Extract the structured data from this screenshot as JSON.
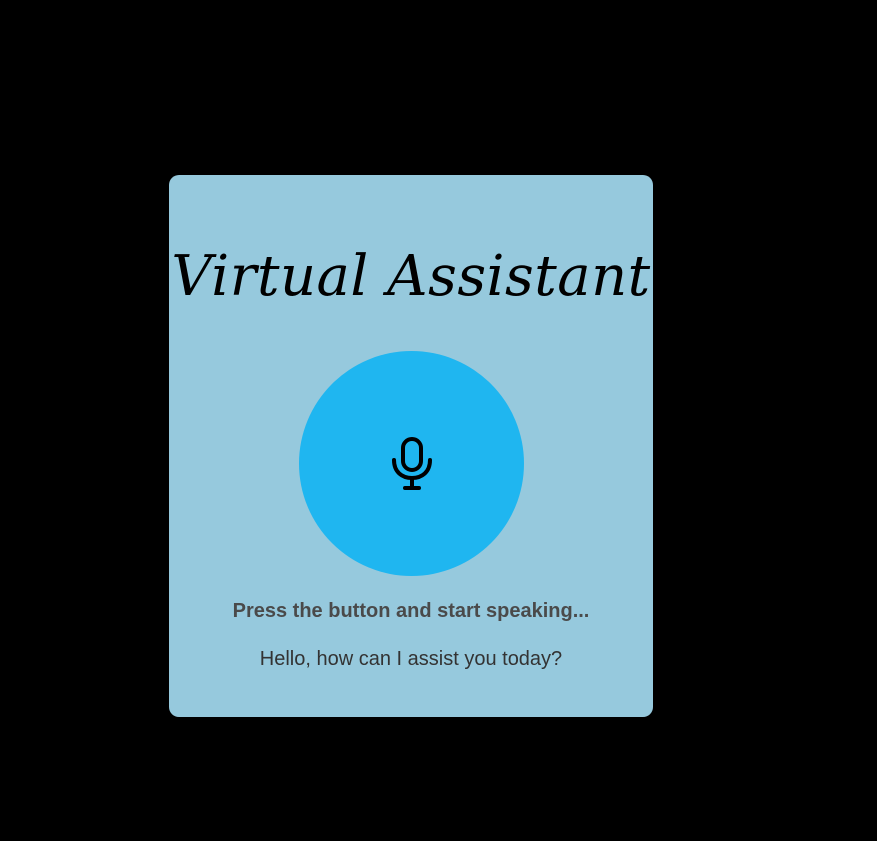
{
  "assistant": {
    "title": "Virtual Assistant",
    "mic_icon": "microphone-icon",
    "prompt": "Press the button and start speaking...",
    "response": "Hello, how can I assist you today?"
  },
  "colors": {
    "page_background": "#000000",
    "card_background": "#96c9dd",
    "button_background": "#1fb6f0",
    "icon": "#000000",
    "prompt_text": "#4a4a4a",
    "response_text": "#333333"
  }
}
